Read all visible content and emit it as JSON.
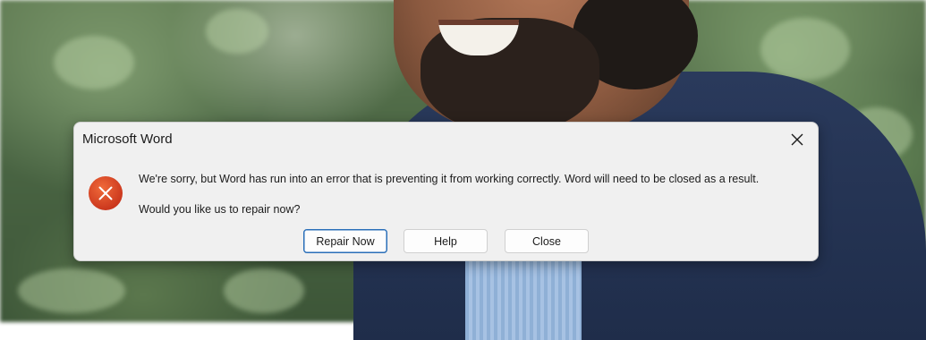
{
  "dialog": {
    "title": "Microsoft Word",
    "message_line1": "We're sorry, but Word has run into an error that is preventing it from working correctly. Word will need to be closed as a result.",
    "message_line2": "Would you like us to repair now?",
    "buttons": {
      "repair": "Repair Now",
      "help": "Help",
      "close": "Close"
    },
    "icons": {
      "close": "close-icon",
      "error": "error-icon"
    },
    "colors": {
      "error_red": "#d9381e",
      "primary_border": "#2a6fb9",
      "dialog_bg": "#f0f0f0"
    }
  }
}
